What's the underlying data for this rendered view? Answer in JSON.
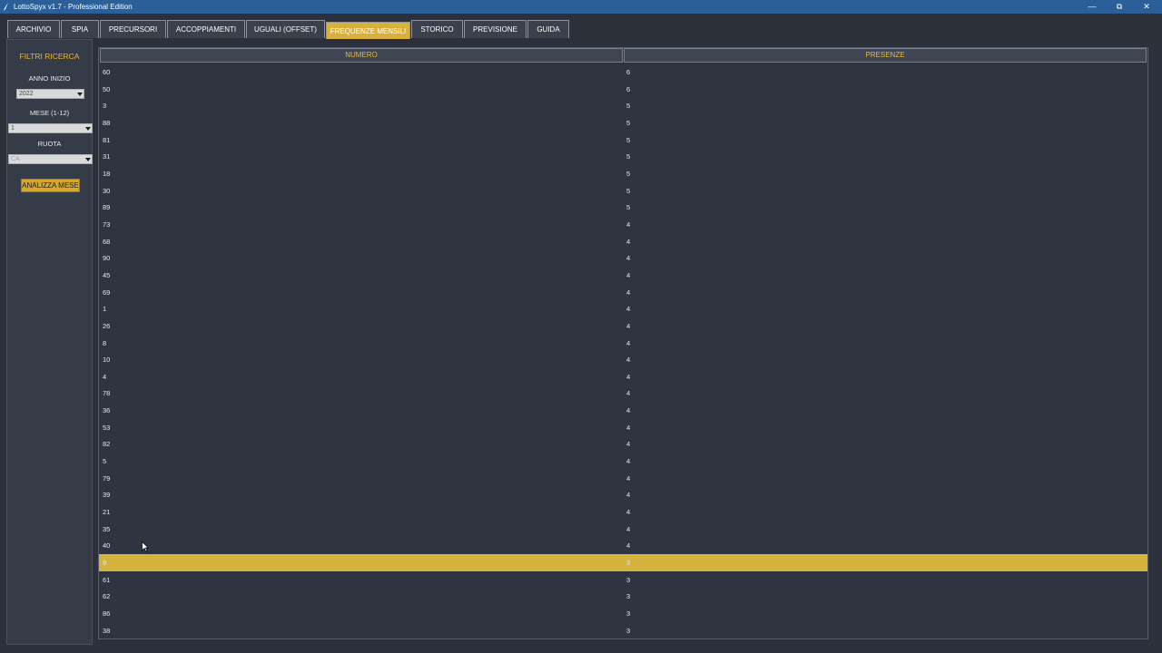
{
  "window": {
    "title": "LottoSpyx v1.7 - Professional Edition",
    "minimize": "—",
    "restore": "⧉",
    "close": "✕"
  },
  "tabs": [
    {
      "label": "ARCHIVIO"
    },
    {
      "label": "SPIA"
    },
    {
      "label": "PRECURSORI"
    },
    {
      "label": "ACCOPPIAMENTI"
    },
    {
      "label": "UGUALI (OFFSET)"
    },
    {
      "label": "FREQUENZE MENSILI"
    },
    {
      "label": "STORICO"
    },
    {
      "label": "PREVISIONE"
    },
    {
      "label": "GUIDA"
    }
  ],
  "active_tab": "FREQUENZE MENSILI",
  "sidebar": {
    "heading": "FILTRI RICERCA",
    "anno_label": "ANNO INIZIO",
    "anno_value": "2022",
    "mese_label": "MESE (1-12)",
    "mese_value": "1",
    "ruota_label": "RUOTA",
    "ruota_value": "CA",
    "analyze_button": "ANALIZZA MESE"
  },
  "table": {
    "columns": [
      "NUMERO",
      "PRESENZE"
    ],
    "rows": [
      {
        "numero": "60",
        "presenze": "6"
      },
      {
        "numero": "50",
        "presenze": "6"
      },
      {
        "numero": "3",
        "presenze": "5"
      },
      {
        "numero": "88",
        "presenze": "5"
      },
      {
        "numero": "81",
        "presenze": "5"
      },
      {
        "numero": "31",
        "presenze": "5"
      },
      {
        "numero": "18",
        "presenze": "5"
      },
      {
        "numero": "30",
        "presenze": "5"
      },
      {
        "numero": "89",
        "presenze": "5"
      },
      {
        "numero": "73",
        "presenze": "4"
      },
      {
        "numero": "68",
        "presenze": "4"
      },
      {
        "numero": "90",
        "presenze": "4"
      },
      {
        "numero": "45",
        "presenze": "4"
      },
      {
        "numero": "69",
        "presenze": "4"
      },
      {
        "numero": "1",
        "presenze": "4"
      },
      {
        "numero": "26",
        "presenze": "4"
      },
      {
        "numero": "8",
        "presenze": "4"
      },
      {
        "numero": "10",
        "presenze": "4"
      },
      {
        "numero": "4",
        "presenze": "4"
      },
      {
        "numero": "78",
        "presenze": "4"
      },
      {
        "numero": "36",
        "presenze": "4"
      },
      {
        "numero": "53",
        "presenze": "4"
      },
      {
        "numero": "82",
        "presenze": "4"
      },
      {
        "numero": "5",
        "presenze": "4"
      },
      {
        "numero": "79",
        "presenze": "4"
      },
      {
        "numero": "39",
        "presenze": "4"
      },
      {
        "numero": "21",
        "presenze": "4"
      },
      {
        "numero": "35",
        "presenze": "4"
      },
      {
        "numero": "40",
        "presenze": "4"
      },
      {
        "numero": "9",
        "presenze": "3",
        "selected": true
      },
      {
        "numero": "61",
        "presenze": "3"
      },
      {
        "numero": "62",
        "presenze": "3"
      },
      {
        "numero": "86",
        "presenze": "3"
      },
      {
        "numero": "38",
        "presenze": "3"
      }
    ]
  },
  "colors": {
    "accent": "#d9b13a",
    "titlebar": "#2b5f97",
    "background": "#2b303b",
    "selected_row": "#d4b23b"
  }
}
